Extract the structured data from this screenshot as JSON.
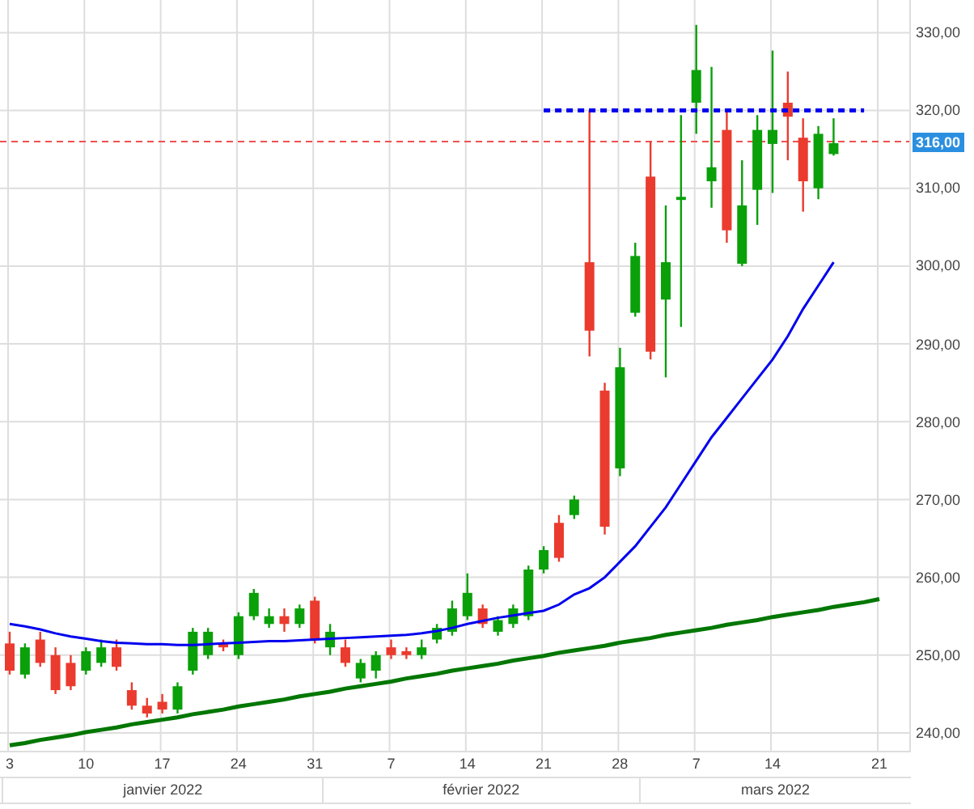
{
  "chart_data": {
    "type": "candlestick",
    "grid": true,
    "ylim": [
      237.5,
      334.2
    ],
    "categories": [
      "3",
      null,
      null,
      null,
      null,
      "10",
      null,
      null,
      null,
      null,
      "17",
      null,
      null,
      null,
      null,
      "24",
      null,
      null,
      null,
      null,
      "31",
      null,
      null,
      null,
      null,
      "7",
      null,
      null,
      null,
      null,
      "14",
      null,
      null,
      null,
      null,
      "21",
      null,
      null,
      null,
      null,
      "28",
      null,
      null,
      null,
      null,
      "7",
      null,
      null,
      null,
      null,
      "14",
      null,
      null,
      null,
      null,
      null,
      null,
      "21"
    ],
    "yticks": [
      {
        "value": 240,
        "label": "240,00"
      },
      {
        "value": 250,
        "label": "250,00"
      },
      {
        "value": 260,
        "label": "260,00"
      },
      {
        "value": 270,
        "label": "270,00"
      },
      {
        "value": 280,
        "label": "280,00"
      },
      {
        "value": 290,
        "label": "290,00"
      },
      {
        "value": 300,
        "label": "300,00"
      },
      {
        "value": 310,
        "label": "310,00"
      },
      {
        "value": 320,
        "label": "320,00"
      },
      {
        "value": 330,
        "label": "330,00"
      }
    ],
    "ohlc": [
      [
        251.5,
        253,
        247.5,
        248
      ],
      [
        247.5,
        251.5,
        247,
        251
      ],
      [
        252,
        253,
        248.5,
        249
      ],
      [
        250,
        251,
        245,
        245.5
      ],
      [
        249,
        250,
        245.5,
        246
      ],
      [
        248,
        251,
        247.5,
        250.5
      ],
      [
        249,
        252,
        248.5,
        251
      ],
      [
        251,
        252,
        248,
        248.5
      ],
      [
        245.5,
        246.5,
        243,
        243.5
      ],
      [
        243.5,
        244.5,
        242,
        242.5
      ],
      [
        244,
        245,
        242.5,
        243
      ],
      [
        243,
        246.5,
        242.5,
        246
      ],
      [
        248,
        253.5,
        247.5,
        253
      ],
      [
        250,
        253.5,
        249.5,
        253
      ],
      [
        251.5,
        252,
        250.5,
        251
      ],
      [
        250,
        255.5,
        249.5,
        255
      ],
      [
        255,
        258.5,
        254.5,
        258
      ],
      [
        254,
        256,
        253.5,
        255
      ],
      [
        255,
        256,
        253,
        254
      ],
      [
        254,
        256.5,
        253.5,
        256
      ],
      [
        257,
        257.5,
        251.5,
        252
      ],
      [
        251,
        254,
        250,
        253
      ],
      [
        251,
        252,
        248.5,
        249
      ],
      [
        247,
        249.5,
        246.5,
        249
      ],
      [
        248,
        250.5,
        247,
        250
      ],
      [
        251,
        252,
        249.5,
        250
      ],
      [
        250.5,
        251,
        249.5,
        250
      ],
      [
        250,
        252,
        249.5,
        251
      ],
      [
        252,
        254,
        251.5,
        253.5
      ],
      [
        253,
        257,
        252.5,
        256
      ],
      [
        255,
        260.5,
        254.5,
        258
      ],
      [
        256,
        256.5,
        253.5,
        254
      ],
      [
        253,
        255,
        252.5,
        254.5
      ],
      [
        254,
        256.5,
        253.5,
        256
      ],
      [
        255,
        261.5,
        254.5,
        261
      ],
      [
        261,
        264,
        260.5,
        263.5
      ],
      [
        267,
        268,
        262,
        262.5
      ],
      [
        268,
        270.5,
        267.5,
        270
      ],
      [
        300.5,
        320,
        288.4,
        291.7
      ],
      [
        284,
        285,
        265.5,
        266.5
      ],
      [
        274,
        289.5,
        273,
        287
      ],
      [
        294,
        303,
        293.5,
        301.3
      ],
      [
        311.5,
        316,
        288,
        289
      ],
      [
        295.7,
        307.8,
        285.7,
        300.5
      ],
      [
        308.5,
        319.4,
        292.2,
        308.9
      ],
      [
        321,
        331,
        317,
        325.2
      ],
      [
        310.9,
        325.6,
        307.5,
        312.7
      ],
      [
        317.5,
        320,
        303,
        304.6
      ],
      [
        300.3,
        313.6,
        300,
        307.8
      ],
      [
        309.8,
        319.4,
        305.3,
        317.5
      ],
      [
        315.7,
        327.7,
        309.4,
        317.5
      ],
      [
        321,
        325,
        313.6,
        319.2
      ],
      [
        316.5,
        319,
        307,
        310.9
      ],
      [
        310,
        318,
        308.6,
        317
      ],
      [
        314.4,
        319,
        314.2,
        315.8
      ],
      null,
      null,
      null
    ],
    "series": [
      {
        "type": "line",
        "color": "#0000ee",
        "values": [
          254.0,
          253.7,
          253.3,
          252.8,
          252.4,
          252.1,
          251.8,
          251.6,
          251.5,
          251.4,
          251.4,
          251.3,
          251.3,
          251.4,
          251.5,
          251.6,
          251.7,
          251.8,
          251.8,
          251.9,
          252.0,
          252.1,
          252.2,
          252.3,
          252.4,
          252.5,
          252.6,
          252.8,
          253.1,
          253.5,
          254.0,
          254.4,
          254.8,
          255.1,
          255.4,
          255.7,
          256.5,
          257.8,
          258.6,
          260.0,
          262.0,
          264.0,
          266.5,
          269.0,
          272.0,
          275.0,
          278.0,
          280.5,
          283.0,
          285.5,
          288.0,
          291.0,
          294.5,
          297.5,
          300.5,
          null,
          null,
          null
        ]
      },
      {
        "type": "line",
        "color": "#007700",
        "values": [
          238.4,
          238.7,
          239.1,
          239.4,
          239.7,
          240.1,
          240.4,
          240.7,
          241.1,
          241.4,
          241.7,
          242.0,
          242.4,
          242.7,
          243.0,
          243.4,
          243.7,
          244.0,
          244.3,
          244.7,
          245.0,
          245.3,
          245.7,
          246.0,
          246.3,
          246.6,
          247.0,
          247.3,
          247.6,
          248.0,
          248.3,
          248.6,
          248.9,
          249.3,
          249.6,
          249.9,
          250.3,
          250.6,
          250.9,
          251.2,
          251.6,
          251.9,
          252.2,
          252.6,
          252.9,
          253.2,
          253.5,
          253.9,
          254.2,
          254.5,
          254.9,
          255.2,
          255.5,
          255.8,
          256.2,
          256.5,
          256.8,
          257.2
        ]
      }
    ],
    "ref_lines": [
      {
        "axis": "y",
        "value": 320,
        "color": "#0000ee"
      },
      {
        "axis": "y",
        "value": 316,
        "label": "316,00",
        "color": "#f05050"
      }
    ],
    "annotations": [
      "janvier 2022",
      "février 2022",
      "mars 2022"
    ]
  }
}
